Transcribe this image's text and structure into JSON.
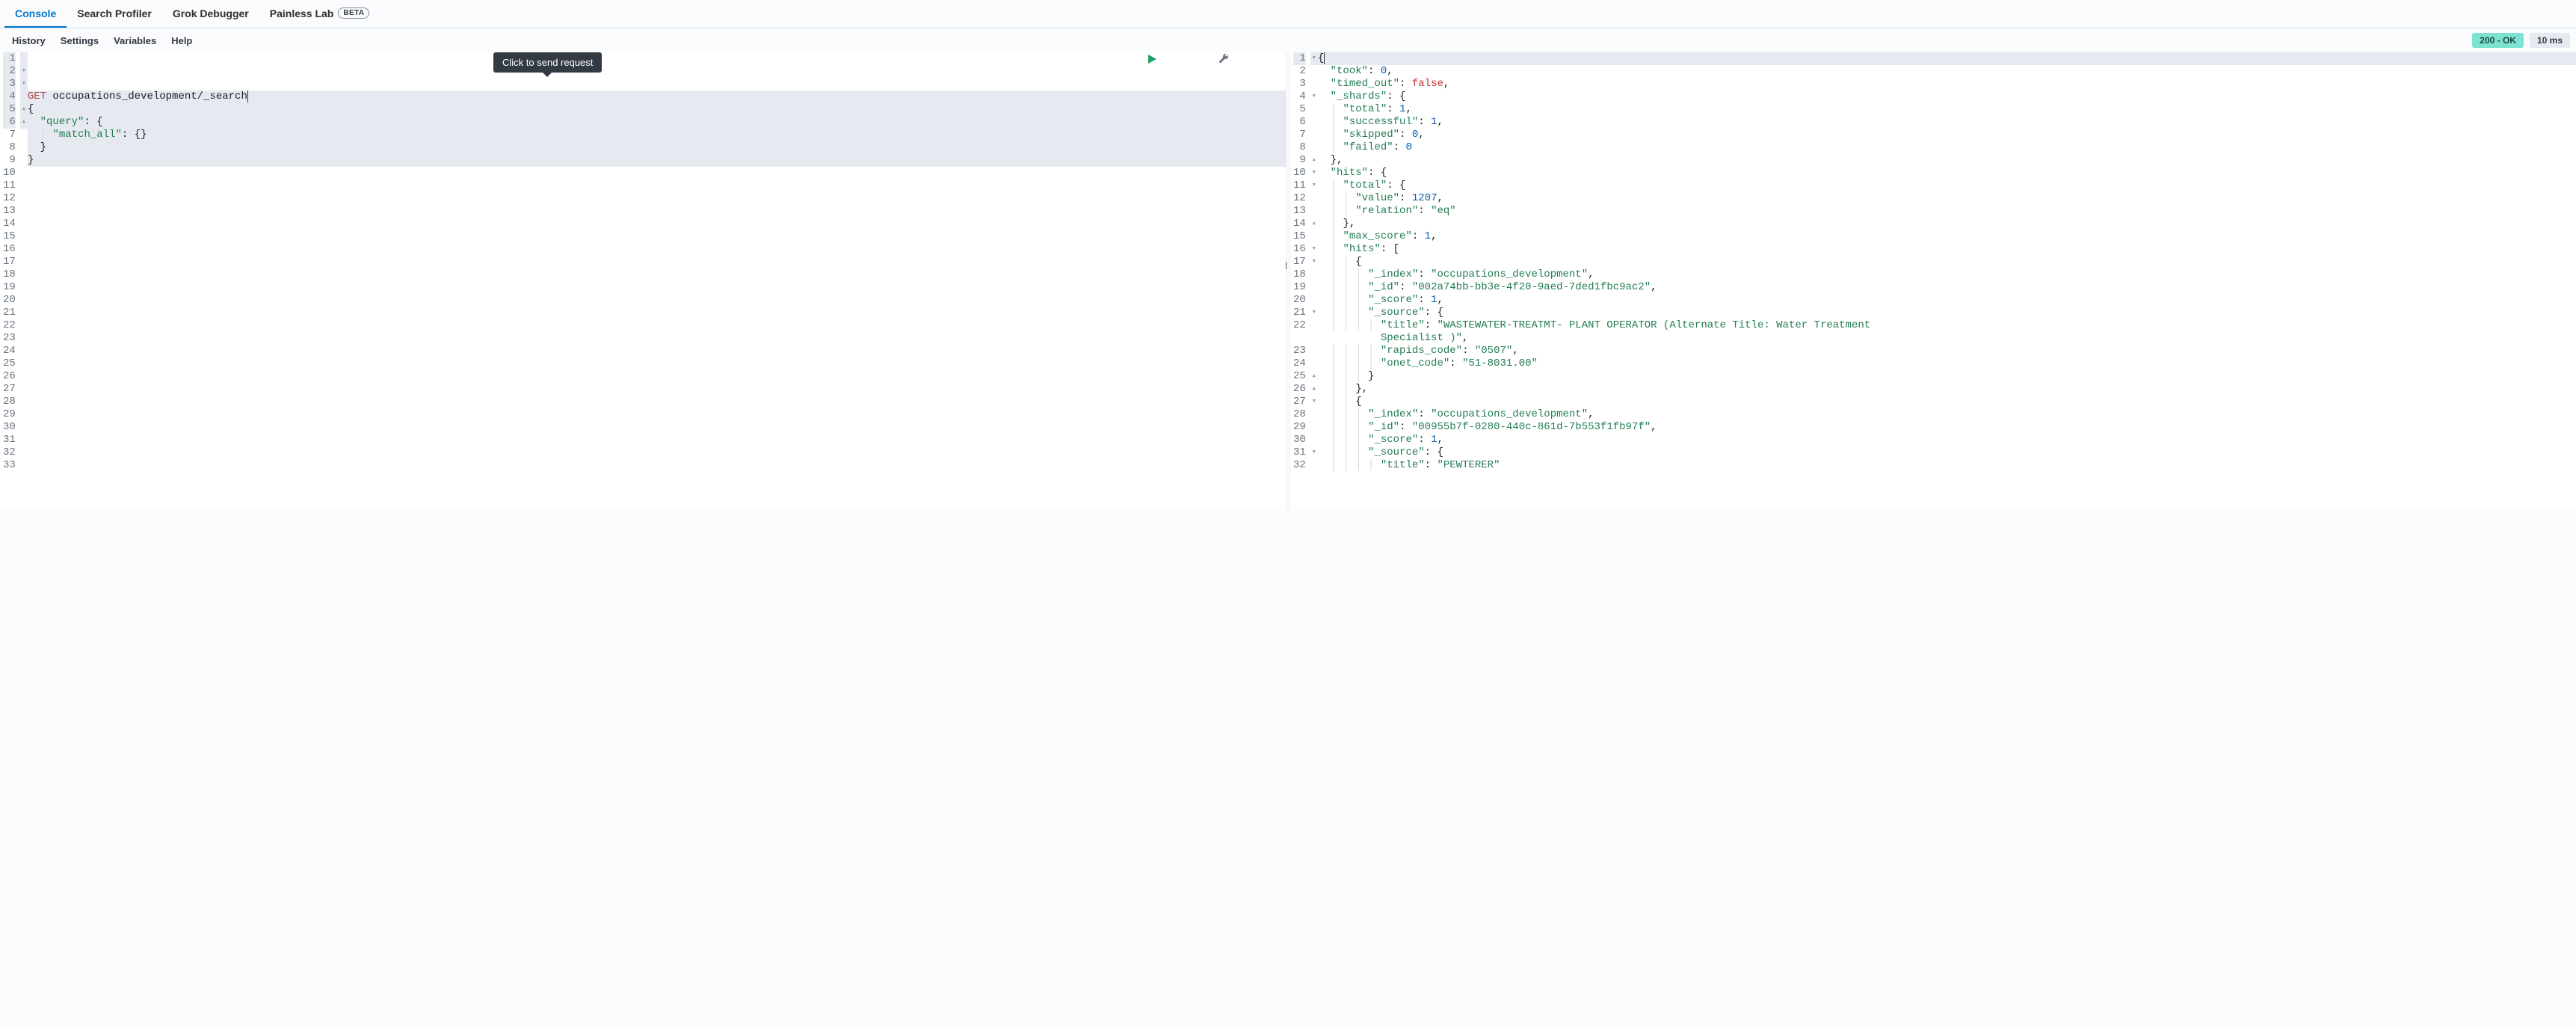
{
  "top_tabs": {
    "console": "Console",
    "search_profiler": "Search Profiler",
    "grok_debugger": "Grok Debugger",
    "painless_lab": "Painless Lab",
    "beta_label": "BETA"
  },
  "sub_tabs": {
    "history": "History",
    "settings": "Settings",
    "variables": "Variables",
    "help": "Help"
  },
  "status": {
    "code": "200 - OK",
    "time": "10 ms"
  },
  "tooltip": "Click to send request",
  "request": {
    "method": "GET",
    "path": "occupations_development/_search",
    "lines": [
      {
        "n": "1",
        "fold": "",
        "tokens": [
          {
            "t": "GET ",
            "c": "t-method"
          },
          {
            "t": "occupations_development/_search",
            "c": ""
          }
        ]
      },
      {
        "n": "2",
        "fold": "▾",
        "tokens": [
          {
            "t": "{",
            "c": "t-punc"
          }
        ]
      },
      {
        "n": "3",
        "fold": "▾",
        "tokens": [
          {
            "t": "  ",
            "c": ""
          },
          {
            "t": "\"query\"",
            "c": "t-key"
          },
          {
            "t": ": {",
            "c": "t-punc"
          }
        ]
      },
      {
        "n": "4",
        "fold": "",
        "tokens": [
          {
            "t": "  ",
            "c": ""
          },
          {
            "t": "│ ",
            "c": "indent-guide"
          },
          {
            "t": "\"match_all\"",
            "c": "t-key"
          },
          {
            "t": ": {}",
            "c": "t-punc"
          }
        ]
      },
      {
        "n": "5",
        "fold": "▴",
        "tokens": [
          {
            "t": "  }",
            "c": "t-punc"
          }
        ]
      },
      {
        "n": "6",
        "fold": "▴",
        "tokens": [
          {
            "t": "}",
            "c": "t-punc"
          }
        ]
      },
      {
        "n": "7",
        "fold": "",
        "tokens": []
      },
      {
        "n": "8",
        "fold": "",
        "tokens": []
      },
      {
        "n": "9",
        "fold": "",
        "tokens": []
      },
      {
        "n": "10",
        "fold": "",
        "tokens": []
      },
      {
        "n": "11",
        "fold": "",
        "tokens": []
      },
      {
        "n": "12",
        "fold": "",
        "tokens": []
      },
      {
        "n": "13",
        "fold": "",
        "tokens": []
      },
      {
        "n": "14",
        "fold": "",
        "tokens": []
      },
      {
        "n": "15",
        "fold": "",
        "tokens": []
      },
      {
        "n": "16",
        "fold": "",
        "tokens": []
      },
      {
        "n": "17",
        "fold": "",
        "tokens": []
      },
      {
        "n": "18",
        "fold": "",
        "tokens": []
      },
      {
        "n": "19",
        "fold": "",
        "tokens": []
      },
      {
        "n": "20",
        "fold": "",
        "tokens": []
      },
      {
        "n": "21",
        "fold": "",
        "tokens": []
      },
      {
        "n": "22",
        "fold": "",
        "tokens": []
      },
      {
        "n": "23",
        "fold": "",
        "tokens": []
      },
      {
        "n": "24",
        "fold": "",
        "tokens": []
      },
      {
        "n": "25",
        "fold": "",
        "tokens": []
      },
      {
        "n": "26",
        "fold": "",
        "tokens": []
      },
      {
        "n": "27",
        "fold": "",
        "tokens": []
      },
      {
        "n": "28",
        "fold": "",
        "tokens": []
      },
      {
        "n": "29",
        "fold": "",
        "tokens": []
      },
      {
        "n": "30",
        "fold": "",
        "tokens": []
      },
      {
        "n": "31",
        "fold": "",
        "tokens": []
      },
      {
        "n": "32",
        "fold": "",
        "tokens": []
      },
      {
        "n": "33",
        "fold": "",
        "tokens": []
      }
    ]
  },
  "response": {
    "lines": [
      {
        "n": "1",
        "fold": "▾",
        "tokens": [
          {
            "t": "{",
            "c": "t-punc"
          }
        ]
      },
      {
        "n": "2",
        "fold": "",
        "tokens": [
          {
            "t": "  ",
            "c": ""
          },
          {
            "t": "\"took\"",
            "c": "t-key"
          },
          {
            "t": ": ",
            "c": "t-punc"
          },
          {
            "t": "0",
            "c": "t-num"
          },
          {
            "t": ",",
            "c": "t-punc"
          }
        ]
      },
      {
        "n": "3",
        "fold": "",
        "tokens": [
          {
            "t": "  ",
            "c": ""
          },
          {
            "t": "\"timed_out\"",
            "c": "t-key"
          },
          {
            "t": ": ",
            "c": "t-punc"
          },
          {
            "t": "false",
            "c": "t-bool"
          },
          {
            "t": ",",
            "c": "t-punc"
          }
        ]
      },
      {
        "n": "4",
        "fold": "▾",
        "tokens": [
          {
            "t": "  ",
            "c": ""
          },
          {
            "t": "\"_shards\"",
            "c": "t-key"
          },
          {
            "t": ": {",
            "c": "t-punc"
          }
        ]
      },
      {
        "n": "5",
        "fold": "",
        "tokens": [
          {
            "t": "  ",
            "c": ""
          },
          {
            "t": "│ ",
            "c": "indent-guide"
          },
          {
            "t": "\"total\"",
            "c": "t-key"
          },
          {
            "t": ": ",
            "c": "t-punc"
          },
          {
            "t": "1",
            "c": "t-num"
          },
          {
            "t": ",",
            "c": "t-punc"
          }
        ]
      },
      {
        "n": "6",
        "fold": "",
        "tokens": [
          {
            "t": "  ",
            "c": ""
          },
          {
            "t": "│ ",
            "c": "indent-guide"
          },
          {
            "t": "\"successful\"",
            "c": "t-key"
          },
          {
            "t": ": ",
            "c": "t-punc"
          },
          {
            "t": "1",
            "c": "t-num"
          },
          {
            "t": ",",
            "c": "t-punc"
          }
        ]
      },
      {
        "n": "7",
        "fold": "",
        "tokens": [
          {
            "t": "  ",
            "c": ""
          },
          {
            "t": "│ ",
            "c": "indent-guide"
          },
          {
            "t": "\"skipped\"",
            "c": "t-key"
          },
          {
            "t": ": ",
            "c": "t-punc"
          },
          {
            "t": "0",
            "c": "t-num"
          },
          {
            "t": ",",
            "c": "t-punc"
          }
        ]
      },
      {
        "n": "8",
        "fold": "",
        "tokens": [
          {
            "t": "  ",
            "c": ""
          },
          {
            "t": "│ ",
            "c": "indent-guide"
          },
          {
            "t": "\"failed\"",
            "c": "t-key"
          },
          {
            "t": ": ",
            "c": "t-punc"
          },
          {
            "t": "0",
            "c": "t-num"
          }
        ]
      },
      {
        "n": "9",
        "fold": "▴",
        "tokens": [
          {
            "t": "  },",
            "c": "t-punc"
          }
        ]
      },
      {
        "n": "10",
        "fold": "▾",
        "tokens": [
          {
            "t": "  ",
            "c": ""
          },
          {
            "t": "\"hits\"",
            "c": "t-key"
          },
          {
            "t": ": {",
            "c": "t-punc"
          }
        ]
      },
      {
        "n": "11",
        "fold": "▾",
        "tokens": [
          {
            "t": "  ",
            "c": ""
          },
          {
            "t": "│ ",
            "c": "indent-guide"
          },
          {
            "t": "\"total\"",
            "c": "t-key"
          },
          {
            "t": ": {",
            "c": "t-punc"
          }
        ]
      },
      {
        "n": "12",
        "fold": "",
        "tokens": [
          {
            "t": "  ",
            "c": ""
          },
          {
            "t": "│ │ ",
            "c": "indent-guide"
          },
          {
            "t": "\"value\"",
            "c": "t-key"
          },
          {
            "t": ": ",
            "c": "t-punc"
          },
          {
            "t": "1207",
            "c": "t-num"
          },
          {
            "t": ",",
            "c": "t-punc"
          }
        ]
      },
      {
        "n": "13",
        "fold": "",
        "tokens": [
          {
            "t": "  ",
            "c": ""
          },
          {
            "t": "│ │ ",
            "c": "indent-guide"
          },
          {
            "t": "\"relation\"",
            "c": "t-key"
          },
          {
            "t": ": ",
            "c": "t-punc"
          },
          {
            "t": "\"eq\"",
            "c": "t-str"
          }
        ]
      },
      {
        "n": "14",
        "fold": "▴",
        "tokens": [
          {
            "t": "  ",
            "c": ""
          },
          {
            "t": "│ ",
            "c": "indent-guide"
          },
          {
            "t": "},",
            "c": "t-punc"
          }
        ]
      },
      {
        "n": "15",
        "fold": "",
        "tokens": [
          {
            "t": "  ",
            "c": ""
          },
          {
            "t": "│ ",
            "c": "indent-guide"
          },
          {
            "t": "\"max_score\"",
            "c": "t-key"
          },
          {
            "t": ": ",
            "c": "t-punc"
          },
          {
            "t": "1",
            "c": "t-num"
          },
          {
            "t": ",",
            "c": "t-punc"
          }
        ]
      },
      {
        "n": "16",
        "fold": "▾",
        "tokens": [
          {
            "t": "  ",
            "c": ""
          },
          {
            "t": "│ ",
            "c": "indent-guide"
          },
          {
            "t": "\"hits\"",
            "c": "t-key"
          },
          {
            "t": ": [",
            "c": "t-punc"
          }
        ]
      },
      {
        "n": "17",
        "fold": "▾",
        "tokens": [
          {
            "t": "  ",
            "c": ""
          },
          {
            "t": "│ │ ",
            "c": "indent-guide"
          },
          {
            "t": "{",
            "c": "t-punc"
          }
        ]
      },
      {
        "n": "18",
        "fold": "",
        "tokens": [
          {
            "t": "  ",
            "c": ""
          },
          {
            "t": "│ │ │ ",
            "c": "indent-guide"
          },
          {
            "t": "\"_index\"",
            "c": "t-key"
          },
          {
            "t": ": ",
            "c": "t-punc"
          },
          {
            "t": "\"occupations_development\"",
            "c": "t-str"
          },
          {
            "t": ",",
            "c": "t-punc"
          }
        ]
      },
      {
        "n": "19",
        "fold": "",
        "tokens": [
          {
            "t": "  ",
            "c": ""
          },
          {
            "t": "│ │ │ ",
            "c": "indent-guide"
          },
          {
            "t": "\"_id\"",
            "c": "t-key"
          },
          {
            "t": ": ",
            "c": "t-punc"
          },
          {
            "t": "\"002a74bb-bb3e-4f20-9aed-7ded1fbc9ac2\"",
            "c": "t-str"
          },
          {
            "t": ",",
            "c": "t-punc"
          }
        ]
      },
      {
        "n": "20",
        "fold": "",
        "tokens": [
          {
            "t": "  ",
            "c": ""
          },
          {
            "t": "│ │ │ ",
            "c": "indent-guide"
          },
          {
            "t": "\"_score\"",
            "c": "t-key"
          },
          {
            "t": ": ",
            "c": "t-punc"
          },
          {
            "t": "1",
            "c": "t-num"
          },
          {
            "t": ",",
            "c": "t-punc"
          }
        ]
      },
      {
        "n": "21",
        "fold": "▾",
        "tokens": [
          {
            "t": "  ",
            "c": ""
          },
          {
            "t": "│ │ │ ",
            "c": "indent-guide"
          },
          {
            "t": "\"_source\"",
            "c": "t-key"
          },
          {
            "t": ": {",
            "c": "t-punc"
          }
        ]
      },
      {
        "n": "22",
        "fold": "",
        "tokens": [
          {
            "t": "  ",
            "c": ""
          },
          {
            "t": "│ │ │ │ ",
            "c": "indent-guide"
          },
          {
            "t": "\"title\"",
            "c": "t-key"
          },
          {
            "t": ": ",
            "c": "t-punc"
          },
          {
            "t": "\"WASTEWATER-TREATMT- PLANT OPERATOR (Alternate Title: Water Treatment ",
            "c": "t-str"
          }
        ]
      },
      {
        "n": "",
        "fold": "",
        "tokens": [
          {
            "t": "          ",
            "c": ""
          },
          {
            "t": "Specialist )\"",
            "c": "t-str"
          },
          {
            "t": ",",
            "c": "t-punc"
          }
        ]
      },
      {
        "n": "23",
        "fold": "",
        "tokens": [
          {
            "t": "  ",
            "c": ""
          },
          {
            "t": "│ │ │ │ ",
            "c": "indent-guide"
          },
          {
            "t": "\"rapids_code\"",
            "c": "t-key"
          },
          {
            "t": ": ",
            "c": "t-punc"
          },
          {
            "t": "\"0507\"",
            "c": "t-str"
          },
          {
            "t": ",",
            "c": "t-punc"
          }
        ]
      },
      {
        "n": "24",
        "fold": "",
        "tokens": [
          {
            "t": "  ",
            "c": ""
          },
          {
            "t": "│ │ │ │ ",
            "c": "indent-guide"
          },
          {
            "t": "\"onet_code\"",
            "c": "t-key"
          },
          {
            "t": ": ",
            "c": "t-punc"
          },
          {
            "t": "\"51-8031.00\"",
            "c": "t-str"
          }
        ]
      },
      {
        "n": "25",
        "fold": "▴",
        "tokens": [
          {
            "t": "  ",
            "c": ""
          },
          {
            "t": "│ │ │ ",
            "c": "indent-guide"
          },
          {
            "t": "}",
            "c": "t-punc"
          }
        ]
      },
      {
        "n": "26",
        "fold": "▴",
        "tokens": [
          {
            "t": "  ",
            "c": ""
          },
          {
            "t": "│ │ ",
            "c": "indent-guide"
          },
          {
            "t": "},",
            "c": "t-punc"
          }
        ]
      },
      {
        "n": "27",
        "fold": "▾",
        "tokens": [
          {
            "t": "  ",
            "c": ""
          },
          {
            "t": "│ │ ",
            "c": "indent-guide"
          },
          {
            "t": "{",
            "c": "t-punc"
          }
        ]
      },
      {
        "n": "28",
        "fold": "",
        "tokens": [
          {
            "t": "  ",
            "c": ""
          },
          {
            "t": "│ │ │ ",
            "c": "indent-guide"
          },
          {
            "t": "\"_index\"",
            "c": "t-key"
          },
          {
            "t": ": ",
            "c": "t-punc"
          },
          {
            "t": "\"occupations_development\"",
            "c": "t-str"
          },
          {
            "t": ",",
            "c": "t-punc"
          }
        ]
      },
      {
        "n": "29",
        "fold": "",
        "tokens": [
          {
            "t": "  ",
            "c": ""
          },
          {
            "t": "│ │ │ ",
            "c": "indent-guide"
          },
          {
            "t": "\"_id\"",
            "c": "t-key"
          },
          {
            "t": ": ",
            "c": "t-punc"
          },
          {
            "t": "\"00955b7f-0280-440c-861d-7b553f1fb97f\"",
            "c": "t-str"
          },
          {
            "t": ",",
            "c": "t-punc"
          }
        ]
      },
      {
        "n": "30",
        "fold": "",
        "tokens": [
          {
            "t": "  ",
            "c": ""
          },
          {
            "t": "│ │ │ ",
            "c": "indent-guide"
          },
          {
            "t": "\"_score\"",
            "c": "t-key"
          },
          {
            "t": ": ",
            "c": "t-punc"
          },
          {
            "t": "1",
            "c": "t-num"
          },
          {
            "t": ",",
            "c": "t-punc"
          }
        ]
      },
      {
        "n": "31",
        "fold": "▾",
        "tokens": [
          {
            "t": "  ",
            "c": ""
          },
          {
            "t": "│ │ │ ",
            "c": "indent-guide"
          },
          {
            "t": "\"_source\"",
            "c": "t-key"
          },
          {
            "t": ": {",
            "c": "t-punc"
          }
        ]
      },
      {
        "n": "32",
        "fold": "",
        "tokens": [
          {
            "t": "  ",
            "c": ""
          },
          {
            "t": "│ │ │ │ ",
            "c": "indent-guide"
          },
          {
            "t": "\"title\"",
            "c": "t-key"
          },
          {
            "t": ": ",
            "c": "t-punc"
          },
          {
            "t": "\"PEWTERER\"",
            "c": "t-str"
          }
        ]
      }
    ]
  }
}
